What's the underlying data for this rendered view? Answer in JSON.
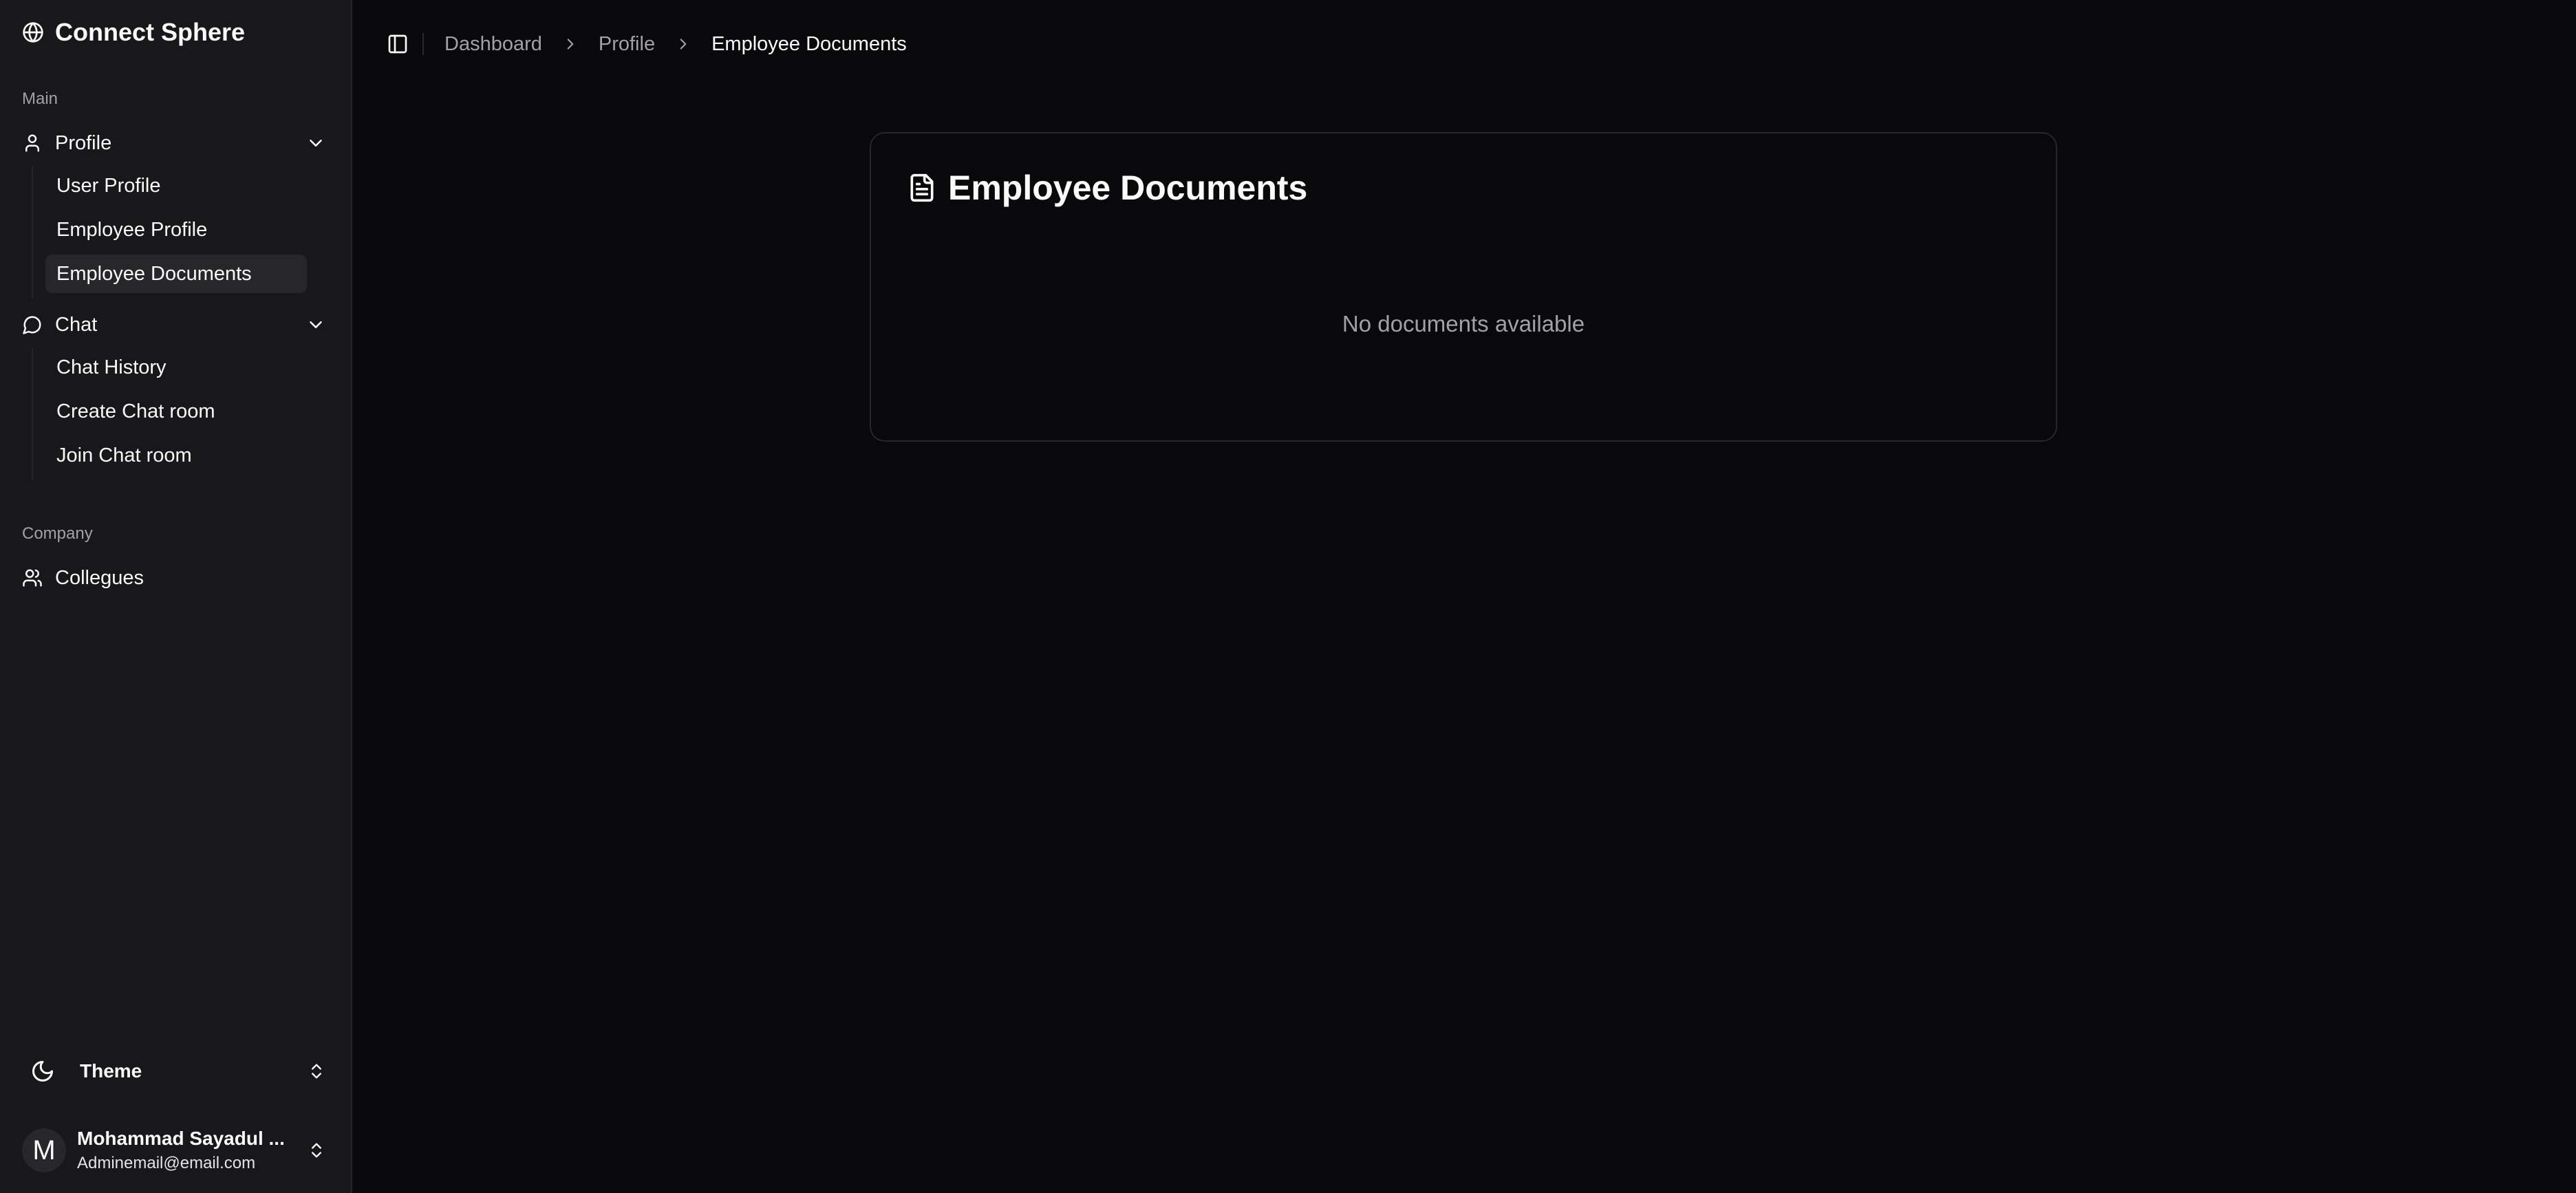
{
  "brand": {
    "name": "Connect Sphere",
    "icon": "globe-icon"
  },
  "sidebar": {
    "groups": [
      {
        "label": "Main",
        "items": [
          {
            "label": "Profile",
            "icon": "user-icon",
            "expanded": true,
            "children": [
              {
                "label": "User Profile",
                "active": false
              },
              {
                "label": "Employee Profile",
                "active": false
              },
              {
                "label": "Employee Documents",
                "active": true
              }
            ]
          },
          {
            "label": "Chat",
            "icon": "message-circle-icon",
            "expanded": true,
            "children": [
              {
                "label": "Chat History",
                "active": false
              },
              {
                "label": "Create Chat room",
                "active": false
              },
              {
                "label": "Join Chat room",
                "active": false
              }
            ]
          }
        ]
      },
      {
        "label": "Company",
        "items": [
          {
            "label": "Collegues",
            "icon": "users-icon"
          }
        ]
      }
    ],
    "footer": {
      "theme_label": "Theme",
      "theme_icon": "moon-icon",
      "user": {
        "initial": "M",
        "name": "Mohammad Sayadul ...",
        "email": "Adminemail@email.com"
      }
    }
  },
  "breadcrumb": {
    "items": [
      "Dashboard",
      "Profile",
      "Employee Documents"
    ]
  },
  "card": {
    "title": "Employee Documents",
    "icon": "file-text-icon",
    "empty_message": "No documents available"
  },
  "colors": {
    "background": "#09090b",
    "sidebar": "#18181b",
    "border": "#27272a",
    "muted_text": "#a1a1aa",
    "text": "#fafafa",
    "active_item": "#27272a"
  }
}
